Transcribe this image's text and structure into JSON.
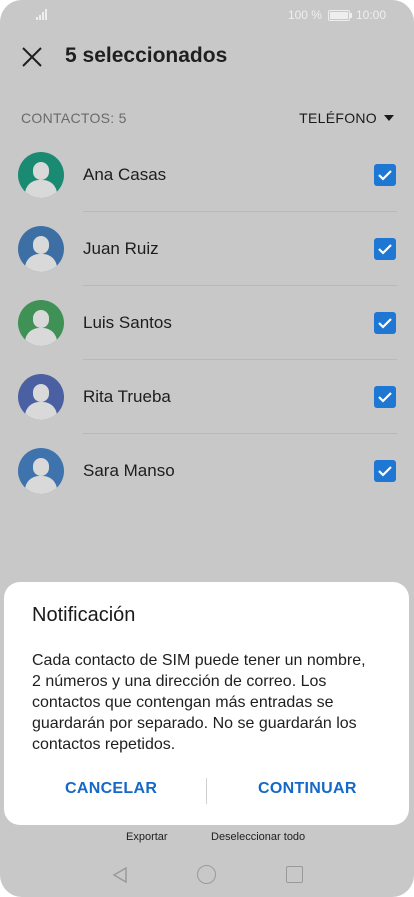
{
  "status_bar": {
    "battery_text": "100 %",
    "time": "10:00"
  },
  "app_bar": {
    "title": "5 seleccionados",
    "close_icon": "close-icon"
  },
  "list_header": {
    "count_label": "CONTACTOS: 5",
    "account_label": "TELÉFONO"
  },
  "contacts": [
    {
      "name": "Ana Casas",
      "avatar_color": "#1a8a72",
      "checked": true
    },
    {
      "name": "Juan Ruiz",
      "avatar_color": "#3d6fa5",
      "checked": true
    },
    {
      "name": "Luis Santos",
      "avatar_color": "#3f9156",
      "checked": true
    },
    {
      "name": "Rita Trueba",
      "avatar_color": "#4b5fa3",
      "checked": true
    },
    {
      "name": "Sara Manso",
      "avatar_color": "#3e73ad",
      "checked": true
    }
  ],
  "bottom_bar": {
    "export_label": "Exportar",
    "deselect_label": "Deseleccionar todo"
  },
  "dialog": {
    "title": "Notificación",
    "message": "Cada contacto de SIM puede tener un nombre, 2 números y una dirección de correo. Los contactos que contengan más entradas se guardarán por separado. No se guardarán los contactos repetidos.",
    "cancel_label": "CANCELAR",
    "continue_label": "CONTINUAR"
  },
  "colors": {
    "accent": "#1468c7",
    "checkbox": "#1f77d4",
    "scrim_background": "#c8c8c8"
  }
}
